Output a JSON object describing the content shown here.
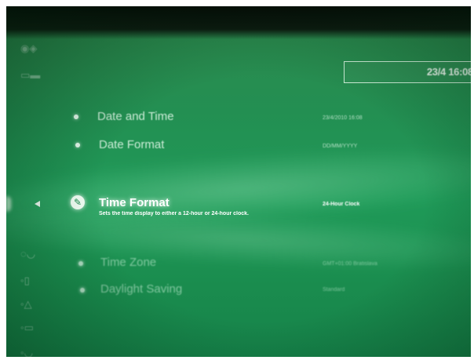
{
  "clock": {
    "text": "23/4 16:08"
  },
  "settings": [
    {
      "label": "Date and Time",
      "value": "23/4/2010 16:08"
    },
    {
      "label": "Date Format",
      "value": "DD/MM/YYYY"
    },
    {
      "label": "Time Format",
      "description": "Sets the time display to either a 12-hour or 24-hour clock.",
      "value": "24-Hour Clock"
    },
    {
      "label": "Time Zone",
      "value": "GMT+01:00 Bratislava"
    },
    {
      "label": "Daylight Saving",
      "value": "Standard"
    }
  ],
  "category_icons": [
    "game-icon",
    "folder-icon",
    "network-icon",
    "controller-icon",
    "user-icon",
    "chat-icon",
    "mic-icon"
  ],
  "colors": {
    "background": "#1f9a58",
    "text": "#e6fbee",
    "selected_text": "#ffffff"
  }
}
